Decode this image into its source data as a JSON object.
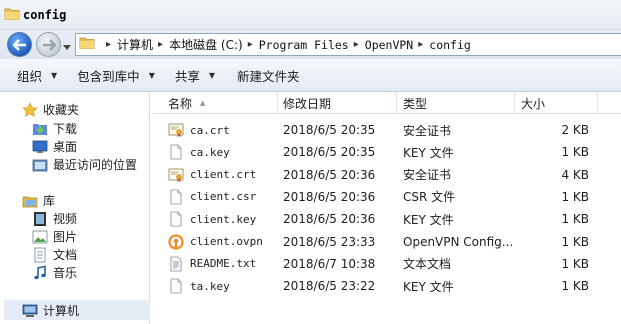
{
  "window": {
    "title": "config"
  },
  "address": {
    "crumbs": [
      "计算机",
      "本地磁盘 (C:)",
      "Program Files",
      "OpenVPN",
      "config"
    ]
  },
  "toolbar": {
    "organize": "组织",
    "include_in_library": "包含到库中",
    "share": "共享",
    "new_folder": "新建文件夹"
  },
  "nav": {
    "favorites": "收藏夹",
    "downloads": "下载",
    "desktop": "桌面",
    "recent_places": "最近访问的位置",
    "libraries": "库",
    "videos": "视频",
    "pictures": "图片",
    "documents": "文档",
    "music": "音乐",
    "computer": "计算机"
  },
  "columns": {
    "name": "名称",
    "date_modified": "修改日期",
    "type": "类型",
    "size": "大小"
  },
  "files": [
    {
      "name": "ca.crt",
      "date": "2018/6/5 20:35",
      "type": "安全证书",
      "size": "2 KB",
      "icon": "certificate-icon"
    },
    {
      "name": "ca.key",
      "date": "2018/6/5 20:35",
      "type": "KEY 文件",
      "size": "1 KB",
      "icon": "file-icon"
    },
    {
      "name": "client.crt",
      "date": "2018/6/5 20:36",
      "type": "安全证书",
      "size": "4 KB",
      "icon": "certificate-icon"
    },
    {
      "name": "client.csr",
      "date": "2018/6/5 20:36",
      "type": "CSR 文件",
      "size": "1 KB",
      "icon": "file-icon"
    },
    {
      "name": "client.key",
      "date": "2018/6/5 20:36",
      "type": "KEY 文件",
      "size": "1 KB",
      "icon": "file-icon"
    },
    {
      "name": "client.ovpn",
      "date": "2018/6/5 23:33",
      "type": "OpenVPN Config...",
      "size": "1 KB",
      "icon": "openvpn-icon"
    },
    {
      "name": "README.txt",
      "date": "2018/6/7 10:38",
      "type": "文本文档",
      "size": "1 KB",
      "icon": "text-file-icon"
    },
    {
      "name": "ta.key",
      "date": "2018/6/5 23:22",
      "type": "KEY 文件",
      "size": "1 KB",
      "icon": "file-icon"
    }
  ]
}
